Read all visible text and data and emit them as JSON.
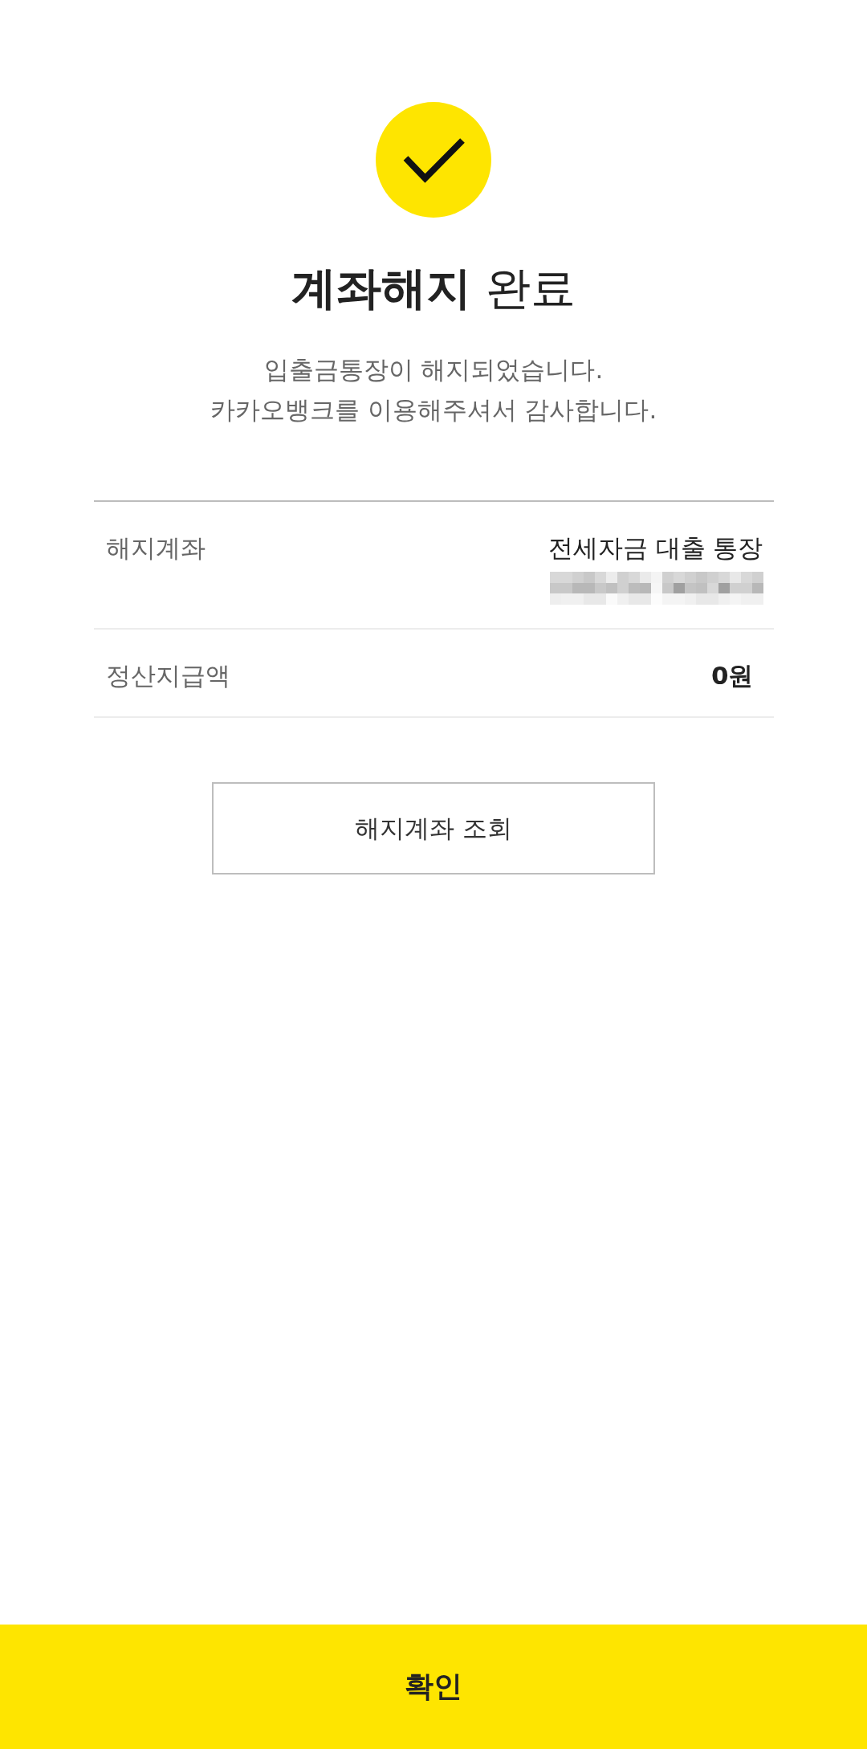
{
  "title": "**계좌해지** 완료",
  "message": [
    "입출금통장이 해지되었습니다.",
    "카카오뱅크를 이용해주셔서 감사합니다."
  ],
  "details": [
    {
      "label": "해지계좌",
      "value": "전세자금 대출 통장",
      "bold": false,
      "number_masked": true
    },
    {
      "label": "정산지급액",
      "value": "0원",
      "bold": true
    }
  ],
  "lookup_button": {
    "label": "해지계좌 조회"
  },
  "confirm_button": {
    "label": "확인"
  }
}
